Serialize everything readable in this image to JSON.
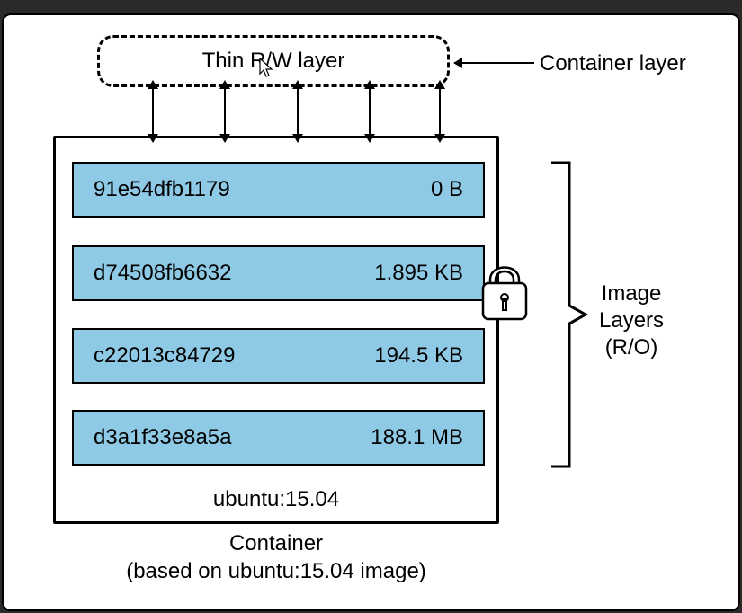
{
  "thin_layer_label": "Thin R/W layer",
  "container_layer_label": "Container layer",
  "layers": [
    {
      "hash": "91e54dfb1179",
      "size": "0 B"
    },
    {
      "hash": "d74508fb6632",
      "size": "1.895 KB"
    },
    {
      "hash": "c22013c84729",
      "size": "194.5 KB"
    },
    {
      "hash": "d3a1f33e8a5a",
      "size": "188.1 MB"
    }
  ],
  "image_tag": "ubuntu:15.04",
  "caption_line1": "Container",
  "caption_line2": "(based on ubuntu:15.04 image)",
  "image_layers_label_line1": "Image",
  "image_layers_label_line2": "Layers",
  "image_layers_label_line3": "(R/O)"
}
